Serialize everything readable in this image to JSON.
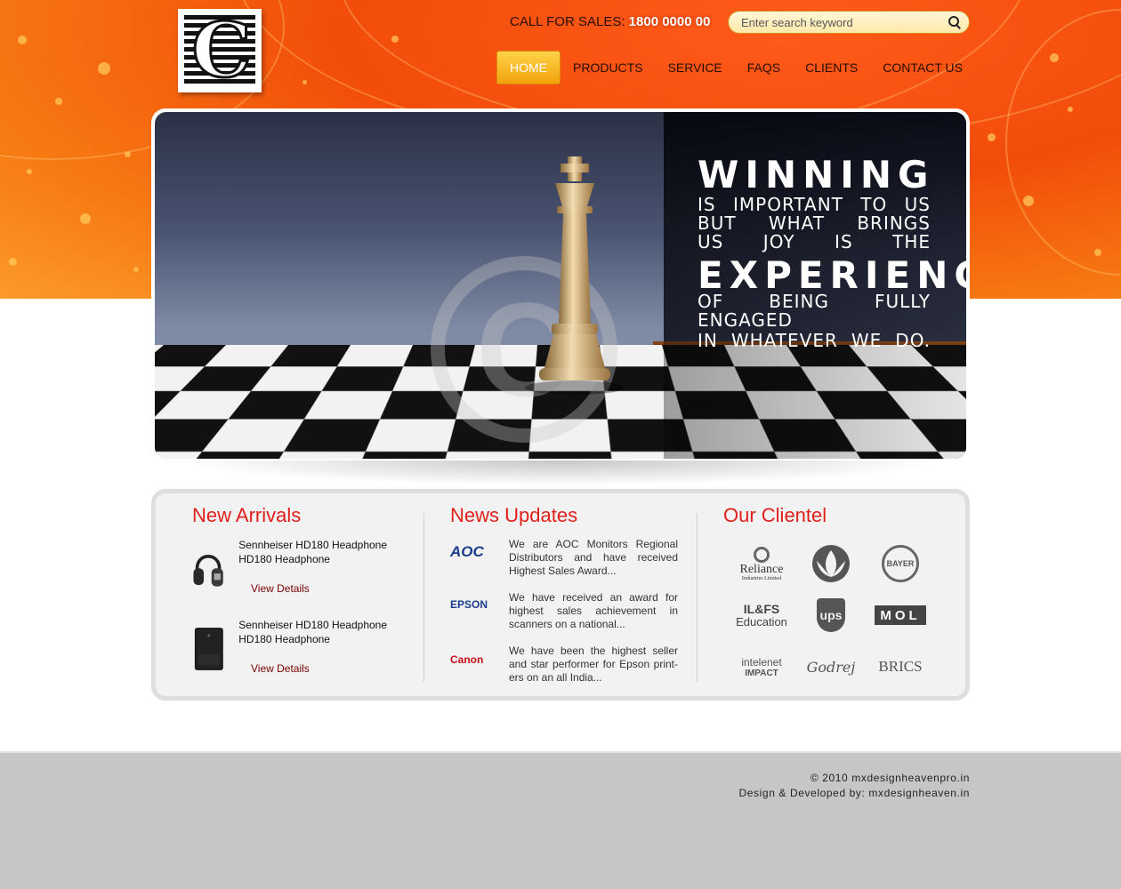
{
  "header": {
    "call_label": "CALL FOR SALES:",
    "call_number": "1800 0000 00",
    "search_placeholder": "Enter search keyword"
  },
  "nav": {
    "items": [
      {
        "label": "HOME",
        "active": true
      },
      {
        "label": "PRODUCTS"
      },
      {
        "label": "SERVICE"
      },
      {
        "label": "FAQS"
      },
      {
        "label": "CLIENTS"
      },
      {
        "label": "CONTACT US"
      }
    ]
  },
  "banner": {
    "line1": "WINNING",
    "line2": "IS IMPORTANT TO US",
    "line3": "BUT WHAT BRINGS",
    "line4": "US JOY IS THE",
    "line5": "EXPERIENCE",
    "line6": "OF BEING FULLY ENGAGED",
    "line7": "IN WHATEVER WE DO."
  },
  "new_arrivals": {
    "title": "New Arrivals",
    "items": [
      {
        "title": "Sennheiser HD180 Headphone HD180 Headphone",
        "link": "View Details"
      },
      {
        "title": "Sennheiser HD180 Headphone HD180 Headphone",
        "link": "View Details"
      }
    ]
  },
  "news": {
    "title": "News Updates",
    "items": [
      {
        "logo": "AOC",
        "text": "We are AOC Monitors Regional Distributors and have received Highest Sales Award..."
      },
      {
        "logo": "EPSON",
        "text": "We have received an award for highest sales achievement in scanners on a national..."
      },
      {
        "logo": "Canon",
        "text": "We have been the highest seller and star performer for Epson print-ers on an all India..."
      }
    ]
  },
  "clientel": {
    "title": "Our Clientel",
    "logos": {
      "reliance": "Reliance",
      "reliance_sub": "Industries Limited",
      "bayer": "BAYER",
      "ilfs": "IL&FS",
      "ilfs_sub": "Education",
      "ups": "ups",
      "mol": "MOL",
      "intelenet": "intelenet",
      "intelenet_sub": "IMPACT",
      "godrej": "Godrej",
      "brics": "BRICS"
    }
  },
  "footer": {
    "copyright": "© 2010  mxdesignheavenpro.in",
    "credit": "Design & Developed by: mxdesignheaven.in"
  },
  "colors": {
    "accent_red": "#e0211b",
    "nav_active": "#f2a20a",
    "hero_orange": "#f24d0a"
  }
}
